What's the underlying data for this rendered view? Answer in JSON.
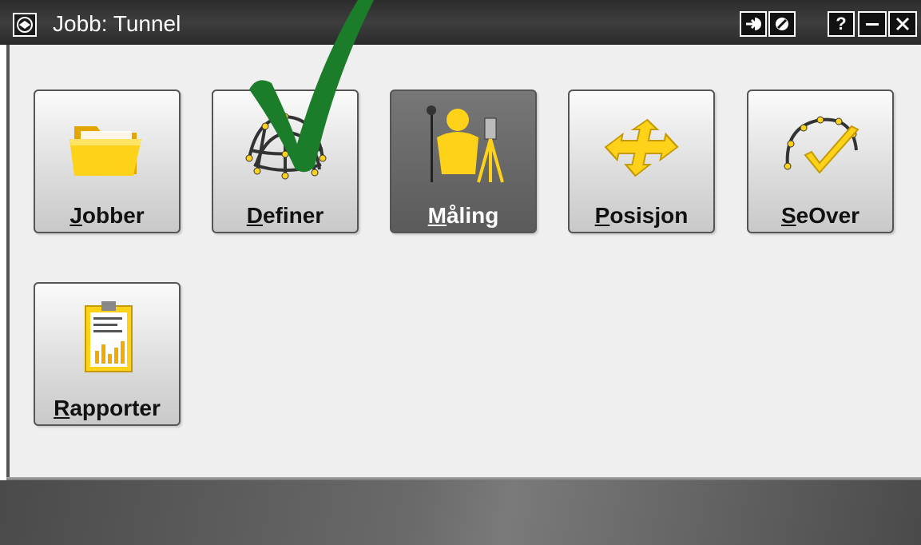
{
  "window": {
    "title": "Jobb: Tunnel",
    "buttons": [
      "login",
      "cancel",
      "help",
      "minimize",
      "close"
    ],
    "help_label": "?"
  },
  "tiles": [
    {
      "first": "J",
      "rest": "obber"
    },
    {
      "first": "D",
      "rest": "efiner"
    },
    {
      "first": "M",
      "rest": "åling"
    },
    {
      "first": "P",
      "rest": "osisjon"
    },
    {
      "first": "S",
      "rest": "eOver"
    },
    {
      "first": "R",
      "rest": "apporter"
    }
  ],
  "colors": {
    "accent_yellow": "#f2c200",
    "checkmark_green": "#1b7d2a",
    "active_tile": "#5f5f5f"
  },
  "icons": [
    "folder-icon",
    "cage-mesh-icon",
    "surveyor-icon",
    "arrows-icon",
    "check-loop-icon",
    "report-clipboard-icon"
  ]
}
